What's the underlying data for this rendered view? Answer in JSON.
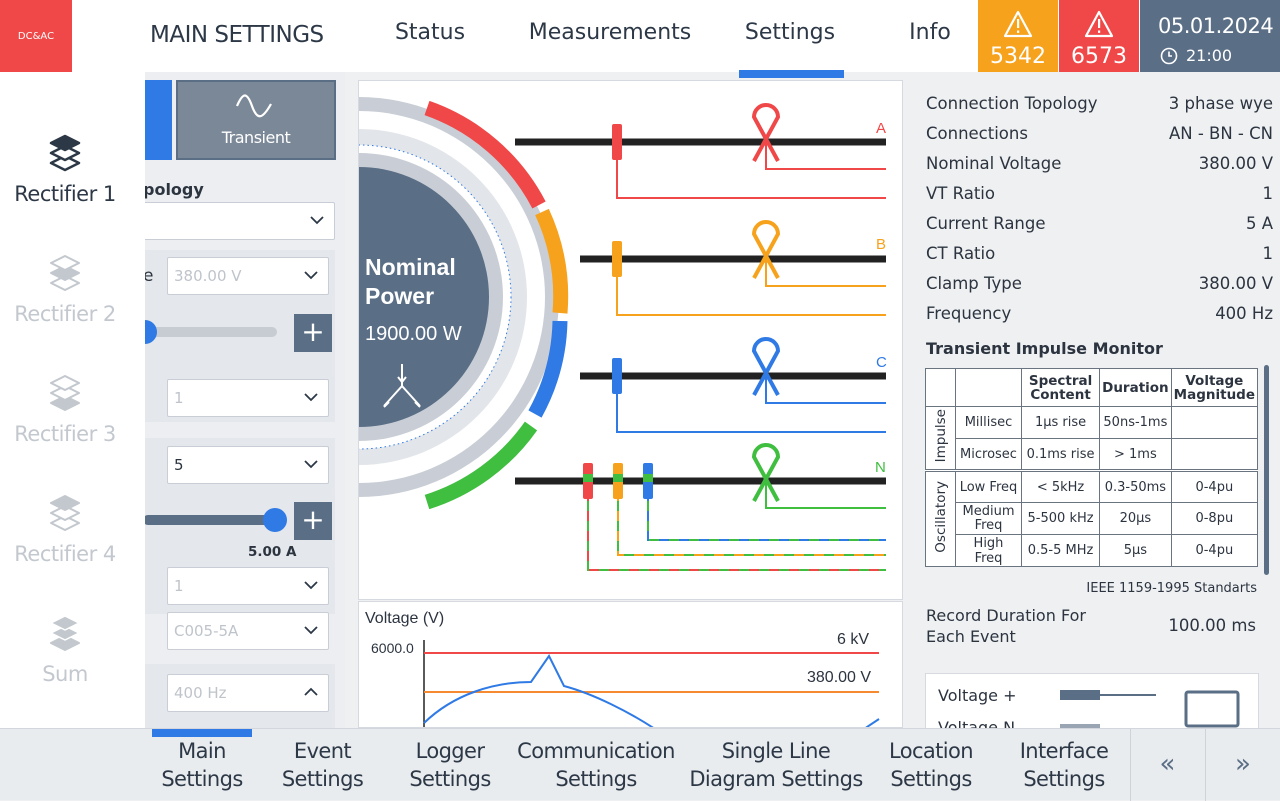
{
  "header": {
    "logo": "DC&AC",
    "title": "MAIN SETTINGS",
    "tabs": [
      {
        "label": "Status"
      },
      {
        "label": "Measurements"
      },
      {
        "label": "Settings",
        "active": true
      },
      {
        "label": "Info"
      }
    ],
    "alarms": [
      {
        "count": "5342",
        "color": "#f6a21c"
      },
      {
        "count": "6573",
        "color": "#f04848"
      }
    ],
    "date": "05.01.2024",
    "time": "21:00"
  },
  "sidebar": {
    "items": [
      {
        "label": "Rectifier 1",
        "active": true
      },
      {
        "label": "Rectifier 2"
      },
      {
        "label": "Rectifier 3"
      },
      {
        "label": "Rectifier 4"
      },
      {
        "label": "Sum"
      }
    ]
  },
  "panel": {
    "mode_button": "Transient",
    "topology_label": "pology",
    "voltage_label": "e",
    "voltage_value": "380.00 V",
    "vt_ratio": "1",
    "current_range": "5",
    "current_readout": "5.00 A",
    "ct_ratio": "1",
    "clamp": "C005-5A",
    "frequency": "400 Hz"
  },
  "diagram": {
    "center_title_1": "Nominal",
    "center_title_2": "Power",
    "center_value": "1900.00 W",
    "phases": [
      "A",
      "B",
      "C",
      "N"
    ],
    "colors": {
      "A": "#f04848",
      "B": "#f6a21c",
      "C": "#2f7ae5",
      "N": "#3fbe3f"
    }
  },
  "chart": {
    "title": "Voltage (V)",
    "y_tick": "6000.0",
    "line_labels": [
      "6 kV",
      "380.00 V"
    ]
  },
  "settings": {
    "rows": [
      {
        "key": "Connection Topology",
        "value": "3 phase wye"
      },
      {
        "key": "Connections",
        "value": "AN - BN - CN"
      },
      {
        "key": "Nominal Voltage",
        "value": "380.00 V"
      },
      {
        "key": "VT Ratio",
        "value": "1"
      },
      {
        "key": "Current Range",
        "value": "5 A"
      },
      {
        "key": "CT Ratio",
        "value": "1"
      },
      {
        "key": "Clamp Type",
        "value": "380.00 V"
      },
      {
        "key": "Frequency",
        "value": "400 Hz"
      }
    ],
    "monitor_title": "Transient Impulse Monitor",
    "table": {
      "headers": [
        "Spectral Content",
        "Duration",
        "Voltage Magnitude"
      ],
      "groups": [
        {
          "name": "Impulse",
          "rows": [
            [
              "Millisec",
              "1µs rise",
              "50ns-1ms",
              ""
            ],
            [
              "Microsec",
              "0.1ms rise",
              "> 1ms",
              ""
            ]
          ]
        },
        {
          "name": "Oscillatory",
          "rows": [
            [
              "Low Freq",
              "< 5kHz",
              "0.3-50ms",
              "0-4pu"
            ],
            [
              "Medium Freq",
              "5-500 kHz",
              "20µs",
              "0-8pu"
            ],
            [
              "High Freq",
              "0.5-5 MHz",
              "5µs",
              "0-4pu"
            ]
          ]
        }
      ]
    },
    "standard": "IEEE 1159-1995 Standarts",
    "record_label": "Record Duration For Each Event",
    "record_value": "100.00 ms",
    "legend": [
      "Voltage +",
      "Voltage N"
    ]
  },
  "bottom_nav": [
    {
      "label": "Main Settings",
      "active": true
    },
    {
      "label": "Event Settings"
    },
    {
      "label": "Logger Settings"
    },
    {
      "label": "Communication Settings"
    },
    {
      "label": "Single Line Diagram Settings"
    },
    {
      "label": "Location Settings"
    },
    {
      "label": "Interface Settings"
    }
  ],
  "nav_arrows": [
    "«",
    "»"
  ]
}
